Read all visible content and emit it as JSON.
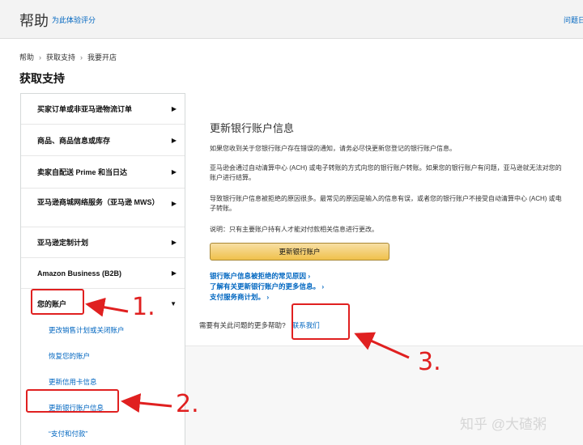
{
  "header": {
    "title": "帮助",
    "subtitle": "为此体验评分",
    "right_link": "问题日"
  },
  "breadcrumb": [
    "帮助",
    "获取支持",
    "我要开店"
  ],
  "page_title": "获取支持",
  "sidebar": {
    "items": [
      {
        "label": "买家订单或非亚马逊物流订单",
        "arrow": "▶"
      },
      {
        "label": "商品、商品信息或库存",
        "arrow": "▶"
      },
      {
        "label": "卖家自配送 Prime 和当日达",
        "arrow": "▶"
      },
      {
        "label": "亚马逊商城网络服务（亚马逊 MWS）",
        "arrow": "▶"
      },
      {
        "label": "亚马逊定制计划",
        "arrow": "▶"
      },
      {
        "label": "Amazon Business (B2B)",
        "arrow": "▶"
      },
      {
        "label": "您的账户",
        "arrow": "▼"
      }
    ],
    "sub_items": [
      {
        "label": "更改销售计划或关闭账户"
      },
      {
        "label": "恢复您的账户"
      },
      {
        "label": "更新信用卡信息"
      },
      {
        "label": "更新银行账户信息"
      },
      {
        "label": "“支付和付款”"
      }
    ]
  },
  "main": {
    "title": "更新银行账户信息",
    "paragraphs": [
      "如果您收到关于您银行账户存在错误的通知，请务必尽快更新您登记的银行账户信息。",
      "亚马逊会通过自动清算中心 (ACH) 或电子转账的方式向您的银行账户转账。如果您的银行账户有问题，亚马逊就无法对您的账户进行结算。",
      "导致银行账户信息被拒绝的原因很多。最常见的原因是输入的信息有误，或者您的银行账户不接受自动清算中心 (ACH) 或电子转账。",
      "说明：只有主要账户持有人才能对付款相关信息进行更改。"
    ],
    "cta_label": "更新银行账户",
    "links": [
      "银行账户信息被拒绝的常见原因 ›",
      "了解有关更新银行账户的更多信息。 ›",
      "支付服务商计划。 ›"
    ],
    "help_question": "需要有关此问题的更多帮助?",
    "contact_label": "联系我们"
  },
  "annotations": {
    "step1": "1.",
    "step2": "2.",
    "step3": "3.",
    "color": "#e02020"
  },
  "watermark": "知乎 @大碴粥"
}
